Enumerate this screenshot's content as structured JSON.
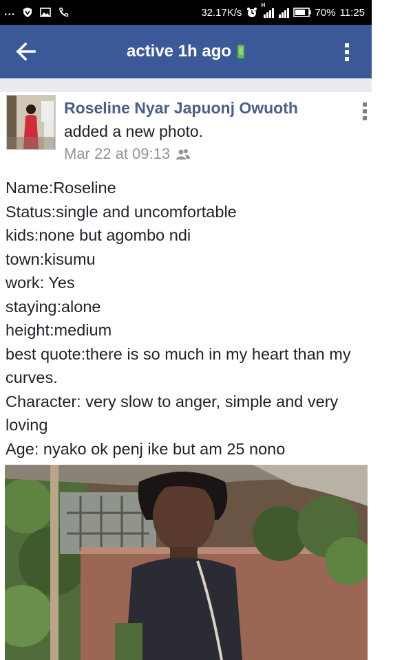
{
  "status_bar": {
    "speed": "32.17K/s",
    "battery": "70%",
    "time": "11:25",
    "network_label": "H",
    "more": "..."
  },
  "app_bar": {
    "title": "active 1h ago",
    "status_color": "#5dbb46"
  },
  "post": {
    "author": "Roseline Nyar Japuonj Owuoth",
    "action": "added a new photo.",
    "date": "Mar 22 at 09:13",
    "lines": [
      "Name:Roseline",
      "Status:single and uncomfortable",
      "kids:none but agombo ndi",
      "town:kisumu",
      "work: Yes",
      "staying:alone",
      "height:medium",
      "best quote:there is so much in my heart than my curves.",
      "Character: very slow to anger, simple and very loving",
      "Age: nyako ok penj ike but am 25 nono"
    ]
  },
  "colors": {
    "brand": "#3b5998",
    "author": "#4b5e86",
    "muted": "#90949c",
    "divider": "#e9ebee"
  }
}
